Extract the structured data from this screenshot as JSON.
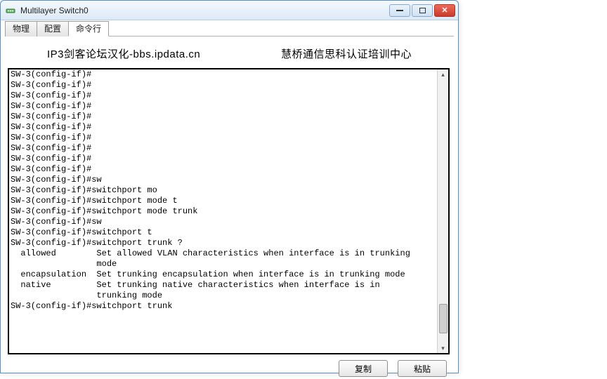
{
  "window": {
    "title": "Multilayer Switch0",
    "controls": {
      "min": "minimize",
      "max": "maximize",
      "close": "close"
    }
  },
  "tabs": {
    "physical": "物理",
    "config": "配置",
    "cli": "命令行"
  },
  "banner": {
    "left": "IP3剑客论坛汉化-bbs.ipdata.cn",
    "right": "慧桥通信思科认证培训中心"
  },
  "terminal_lines": [
    "SW-3(config-if)#",
    "SW-3(config-if)#",
    "SW-3(config-if)#",
    "SW-3(config-if)#",
    "SW-3(config-if)#",
    "SW-3(config-if)#",
    "SW-3(config-if)#",
    "SW-3(config-if)#",
    "SW-3(config-if)#",
    "SW-3(config-if)#",
    "SW-3(config-if)#sw",
    "SW-3(config-if)#switchport mo",
    "SW-3(config-if)#switchport mode t",
    "SW-3(config-if)#switchport mode trunk",
    "SW-3(config-if)#sw",
    "SW-3(config-if)#switchport t",
    "SW-3(config-if)#switchport trunk ?",
    "  allowed        Set allowed VLAN characteristics when interface is in trunking",
    "                 mode",
    "  encapsulation  Set trunking encapsulation when interface is in trunking mode",
    "  native         Set trunking native characteristics when interface is in",
    "                 trunking mode",
    "SW-3(config-if)#switchport trunk"
  ],
  "buttons": {
    "copy": "复制",
    "paste": "粘贴"
  }
}
